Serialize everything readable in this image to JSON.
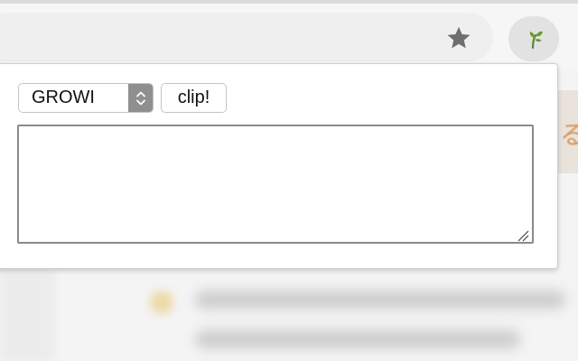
{
  "toolbar": {
    "bookmark_icon": "star-icon",
    "extension_icon": "growi-leaf-icon",
    "extension_icon_color": "#5a8a2e"
  },
  "popup": {
    "site_select": {
      "selected": "GROWI",
      "icon": "up-down-chevron-icon"
    },
    "clip_label": "clip!",
    "textarea_value": "",
    "resize_icon": "resize-grip-icon"
  },
  "background_page": {
    "visible_char": "る",
    "accent_color": "#d8965a"
  }
}
